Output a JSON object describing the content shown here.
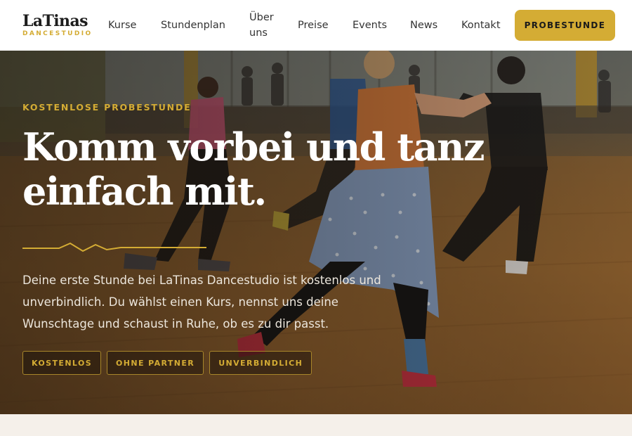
{
  "brand": {
    "name": "LaTinas",
    "tagline": "DANCESTUDIO"
  },
  "nav": {
    "items": [
      {
        "label": "Kurse"
      },
      {
        "label": "Stundenplan"
      },
      {
        "label": "Über"
      },
      {
        "label": "uns"
      },
      {
        "label": "Preise"
      },
      {
        "label": "Events"
      },
      {
        "label": "News"
      },
      {
        "label": "Kontakt"
      }
    ],
    "cta_label": "PROBESTUNDE"
  },
  "hero": {
    "eyebrow": "KOSTENLOSE PROBESTUNDE",
    "headline_line1": "Komm vorbei und tanz",
    "headline_line2": "einfach mit.",
    "lead_line1": "Deine erste Stunde bei LaTinas Dancestudio ist kostenlos und",
    "lead_line2": "unverbindlich. Du wählst einen Kurs, nennst uns deine",
    "lead_line3": "Wunschtage und schaust in Ruhe, ob es zu dir passt.",
    "badges": [
      "KOSTENLOS",
      "OHNE PARTNER",
      "UNVERBINDLICH"
    ]
  },
  "colors": {
    "accent": "#d4ac34",
    "nav_bg": "#ffffff",
    "page_bg": "#f5f0ea",
    "text_dark": "#1d1d1d"
  },
  "icons": [
    "zigzag-divider"
  ]
}
